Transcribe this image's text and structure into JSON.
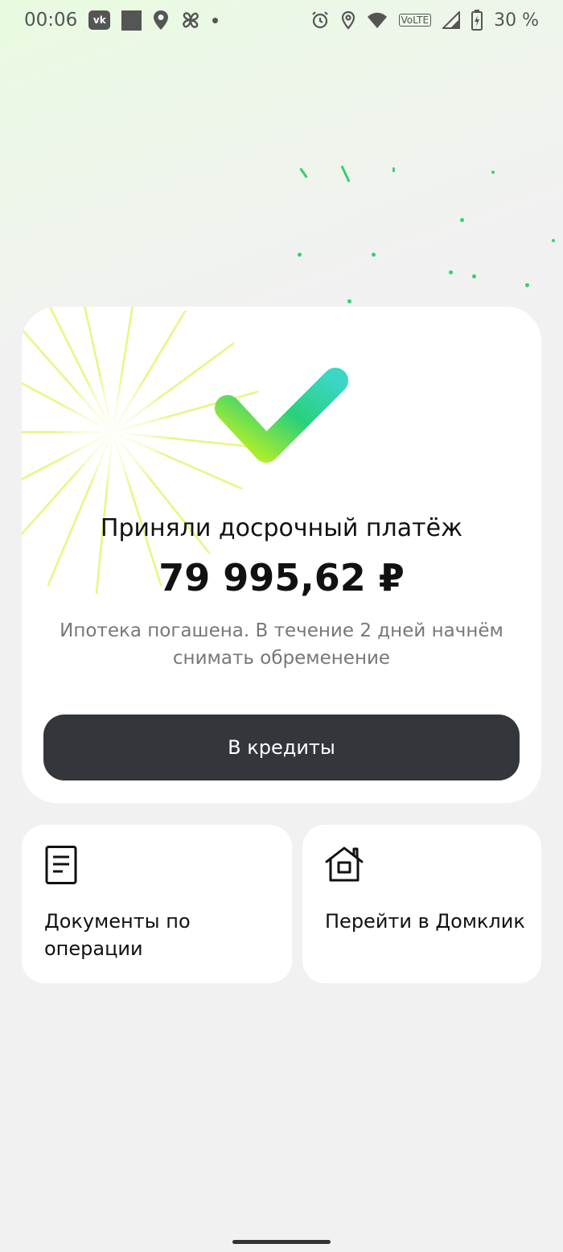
{
  "status_bar": {
    "time": "00:06",
    "notification_icons": [
      "vk-icon",
      "image-icon",
      "location-icon",
      "fan-icon",
      "dot-icon"
    ],
    "system_icons": [
      "alarm-icon",
      "location-icon",
      "wifi-icon",
      "volte-icon",
      "signal-icon",
      "battery-charging-icon"
    ],
    "volte_label": "VoLTE",
    "battery_level": "30 %"
  },
  "confirmation": {
    "title": "Приняли досрочный платёж",
    "amount": "79 995,62 ₽",
    "description": "Ипотека погашена. В течение 2 дней начнём снимать обременение",
    "button_label": "В кредиты",
    "icon": "checkmark-icon"
  },
  "actions": [
    {
      "label": "Документы по операции",
      "icon": "document-icon"
    },
    {
      "label": "Перейти в Домклик",
      "icon": "house-icon"
    }
  ],
  "colors": {
    "background": "#f1f1f1",
    "card": "#ffffff",
    "button": "#33373b",
    "check_start": "#c8f31c",
    "check_end": "#3bd6c6",
    "sparkle": "#35d26a"
  }
}
